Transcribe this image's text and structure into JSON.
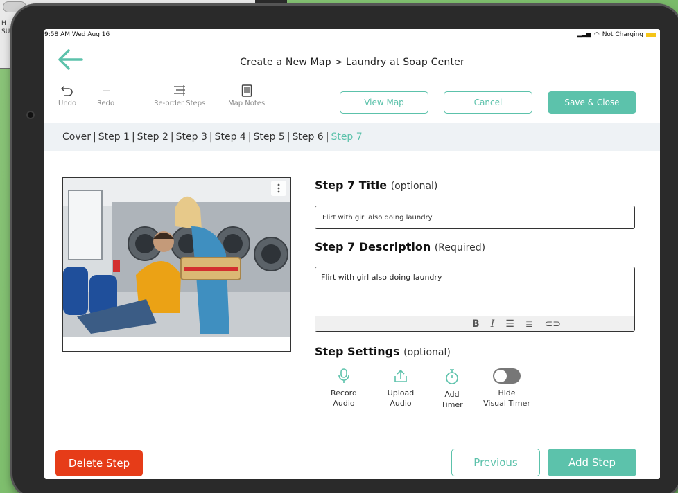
{
  "status_bar": {
    "time": "9:58 AM  Wed Aug 16",
    "charging": "Not Charging"
  },
  "header": {
    "title": "Create a New Map > Laundry at Soap Center"
  },
  "toolbar": {
    "undo": "Undo",
    "redo": "Redo",
    "reorder": "Re-order Steps",
    "notes": "Map Notes",
    "view_map": "View Map",
    "cancel": "Cancel",
    "save_close": "Save & Close"
  },
  "steps_nav": {
    "items": [
      "Cover",
      "Step 1",
      "Step 2",
      "Step 3",
      "Step 4",
      "Step 5",
      "Step 6"
    ],
    "active": "Step 7",
    "separator": "|"
  },
  "form": {
    "title_label": "Step 7 Title",
    "title_optional": "(optional)",
    "title_value": "Flirt with girl also doing laundry",
    "desc_label": "Step 7 Description",
    "desc_required": "(Required)",
    "desc_value": "Flirt with girl also doing laundry",
    "settings_label": "Step Settings",
    "settings_optional": "(optional)"
  },
  "settings": {
    "record_audio_1": "Record",
    "record_audio_2": "Audio",
    "upload_audio_1": "Upload",
    "upload_audio_2": "Audio",
    "add_timer_1": "Add",
    "add_timer_2": "Timer",
    "hide_timer_1": "Hide",
    "hide_timer_2": "Visual Timer",
    "hide_timer_on": false
  },
  "footer": {
    "delete": "Delete Step",
    "previous": "Previous",
    "add": "Add Step"
  },
  "colors": {
    "accent": "#5cc2ab",
    "danger": "#e63c18",
    "nav_bg": "#eef2f5"
  }
}
